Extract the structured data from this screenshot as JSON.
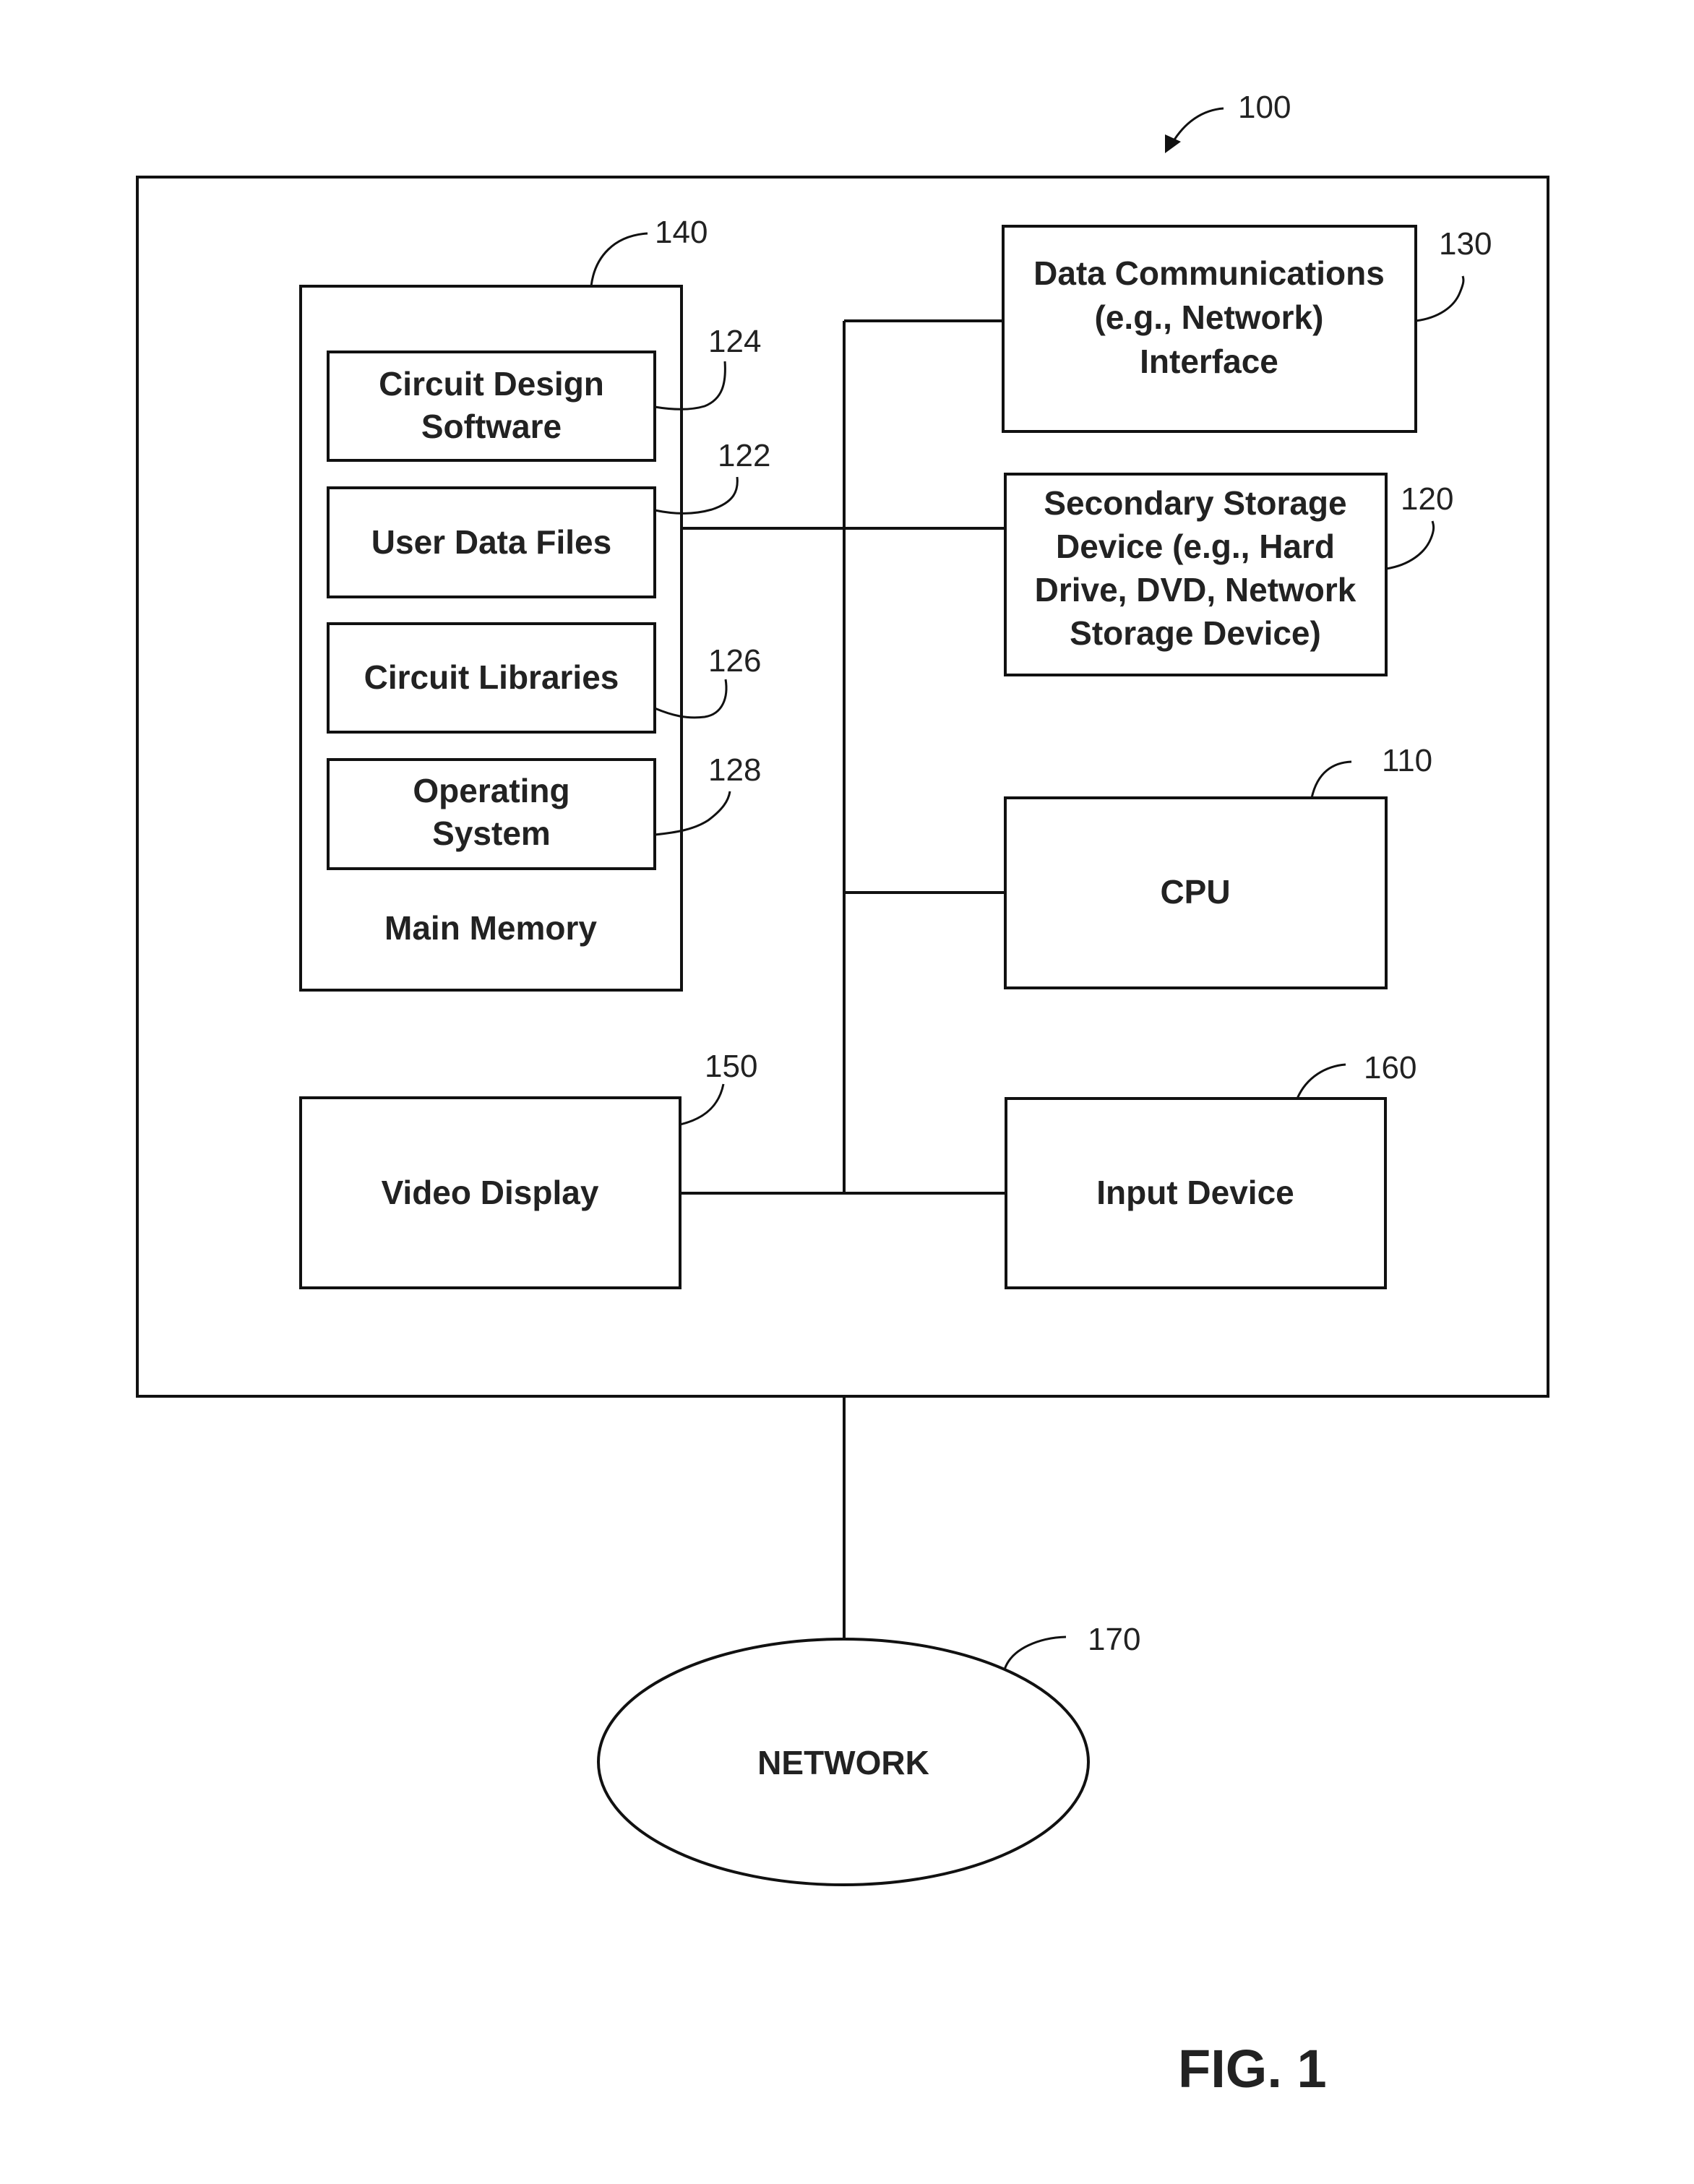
{
  "figure": {
    "caption": "FIG. 1",
    "system_ref": "100"
  },
  "main_memory": {
    "ref": "140",
    "label": "Main Memory",
    "items": [
      {
        "ref": "124",
        "lines": [
          "Circuit Design",
          "Software"
        ]
      },
      {
        "ref": "122",
        "lines": [
          "User Data Files"
        ]
      },
      {
        "ref": "126",
        "lines": [
          "Circuit Libraries"
        ]
      },
      {
        "ref": "128",
        "lines": [
          "Operating",
          "System"
        ]
      }
    ]
  },
  "components": {
    "data_comm": {
      "ref": "130",
      "lines": [
        "Data Communications",
        "(e.g., Network)",
        "Interface"
      ]
    },
    "secondary_storage": {
      "ref": "120",
      "lines": [
        "Secondary Storage",
        "Device (e.g., Hard",
        "Drive, DVD, Network",
        "Storage Device)"
      ]
    },
    "cpu": {
      "ref": "110",
      "lines": [
        "CPU"
      ]
    },
    "video_display": {
      "ref": "150",
      "lines": [
        "Video Display"
      ]
    },
    "input_device": {
      "ref": "160",
      "lines": [
        "Input Device"
      ]
    },
    "network": {
      "ref": "170",
      "label": "NETWORK"
    }
  }
}
